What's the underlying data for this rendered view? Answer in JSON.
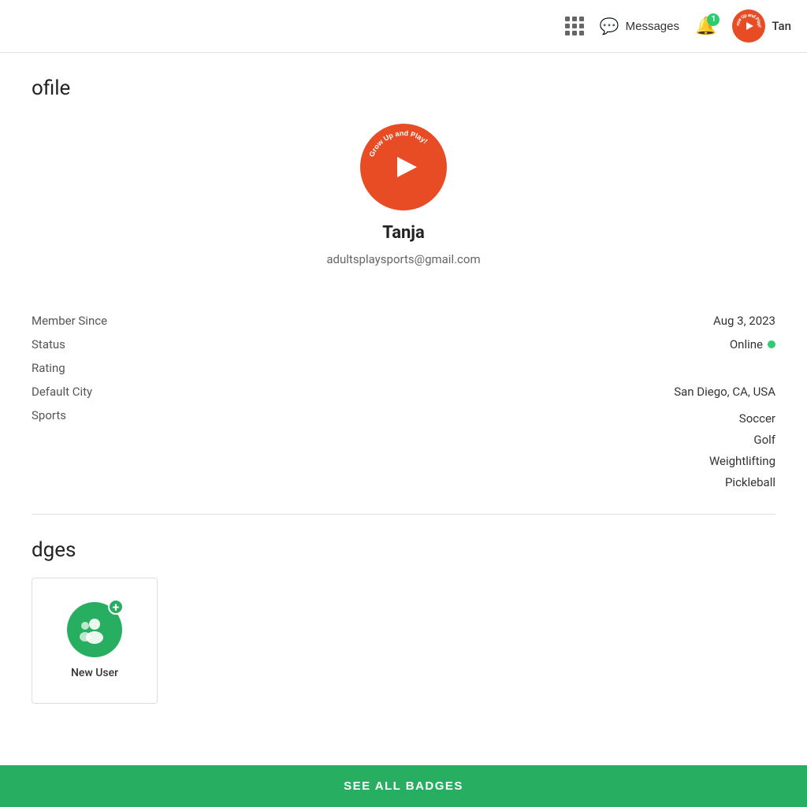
{
  "header": {
    "messages_label": "Messages",
    "notification_count": "1",
    "username": "Tan"
  },
  "page": {
    "title": "ofile",
    "badges_title": "dges"
  },
  "profile": {
    "name": "Tanja",
    "email": "adultsplaysports@gmail.com",
    "member_since_label": "Member Since",
    "member_since_value": "Aug 3, 2023",
    "status_label": "Status",
    "status_value": "Online",
    "rating_label": "Rating",
    "rating_value": "",
    "default_city_label": "Default City",
    "default_city_value": "San Diego, CA, USA",
    "sports_label": "Sports",
    "sports": [
      "Soccer",
      "Golf",
      "Weightlifting",
      "Pickleball"
    ]
  },
  "badges": {
    "new_user_label": "New User"
  },
  "footer": {
    "see_all_badges": "SEE ALL BADGES"
  }
}
